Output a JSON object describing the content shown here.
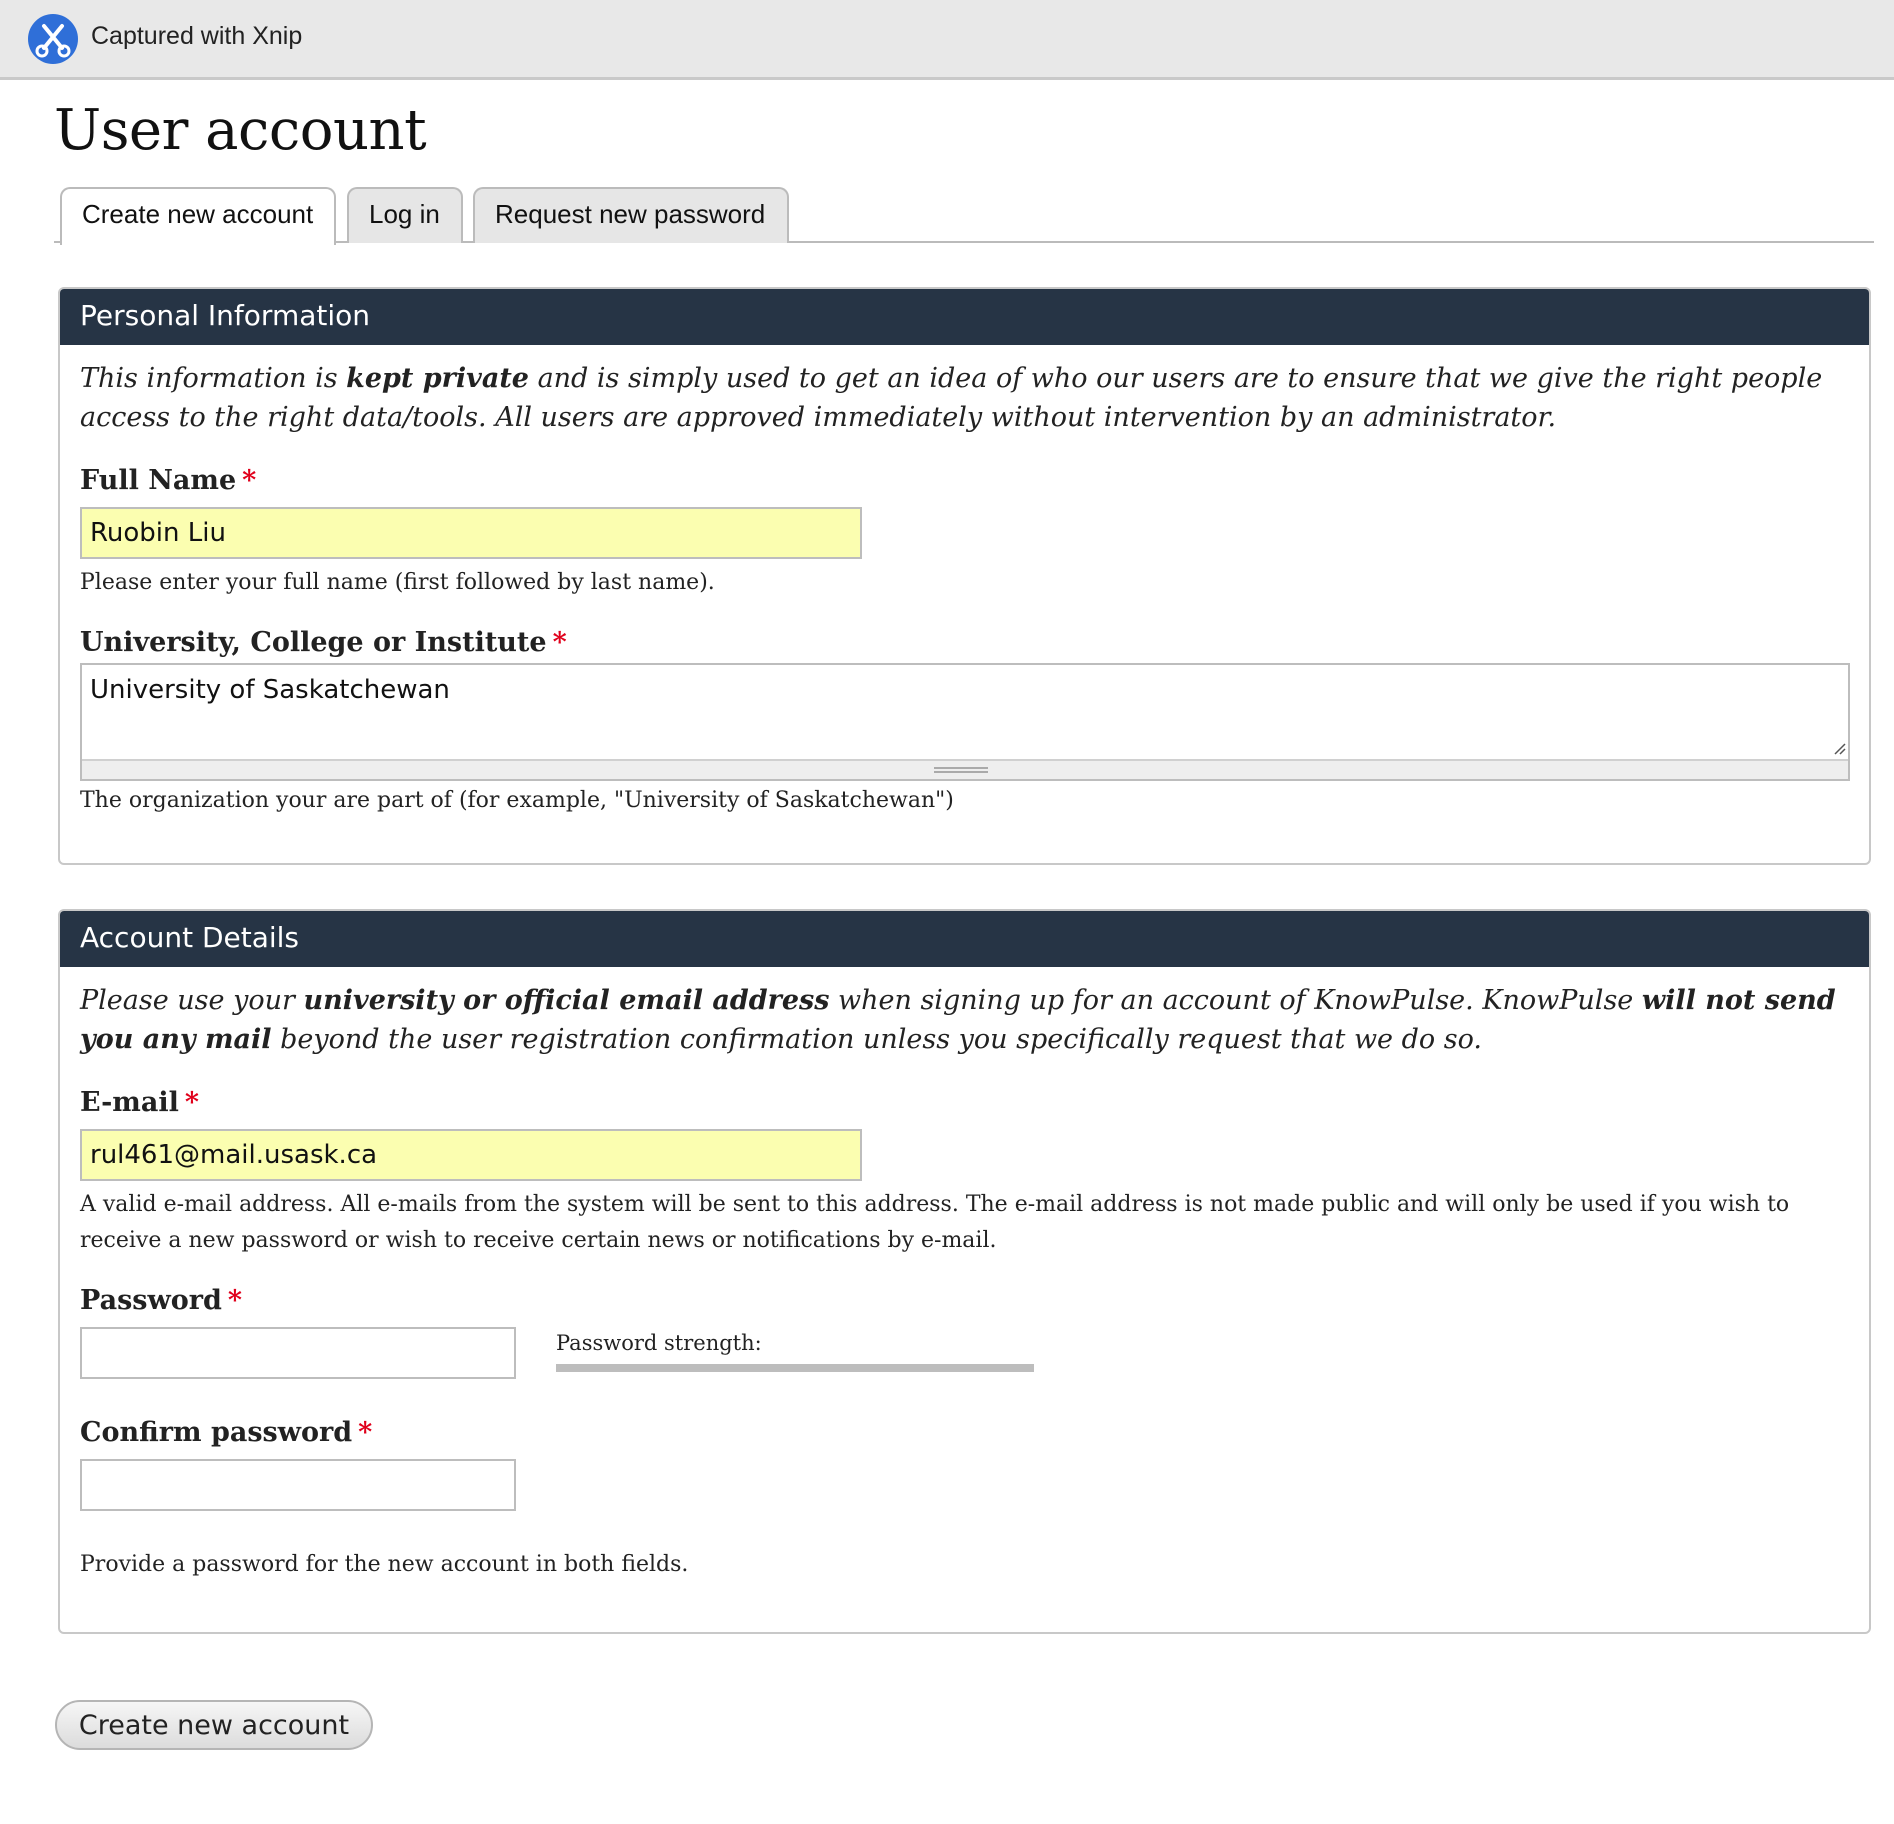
{
  "capture_bar": {
    "text": "Captured with Xnip",
    "icon": "scissors-icon",
    "accent": "#2f6fd8"
  },
  "page": {
    "title": "User account"
  },
  "tabs": [
    {
      "label": "Create new account",
      "active": true
    },
    {
      "label": "Log in",
      "active": false
    },
    {
      "label": "Request new password",
      "active": false
    }
  ],
  "personal": {
    "legend": "Personal Information",
    "intro_1": "This information is ",
    "intro_bold": "kept private",
    "intro_2": " and is simply used to get an idea of who our users are to ensure that we give the right people access to the right data/tools. All users are approved immediately without intervention by an administrator.",
    "full_name": {
      "label": "Full Name",
      "required": "*",
      "value": "Ruobin Liu",
      "help": "Please enter your full name (first followed by last name)."
    },
    "institute": {
      "label": "University, College or Institute",
      "required": "*",
      "value": "University of Saskatchewan",
      "help": "The organization your are part of (for example, \"University of Saskatchewan\")"
    }
  },
  "account": {
    "legend": "Account Details",
    "intro_1": "Please use your ",
    "intro_bold_1": "university or official email address",
    "intro_2": " when signing up for an account of KnowPulse. KnowPulse ",
    "intro_bold_2": "will not send you any mail",
    "intro_3": " beyond the user registration confirmation unless you specifically request that we do so.",
    "email": {
      "label": "E-mail",
      "required": "*",
      "value": "rul461@mail.usask.ca",
      "help": "A valid e-mail address. All e-mails from the system will be sent to this address. The e-mail address is not made public and will only be used if you wish to receive a new password or wish to receive certain news or notifications by e-mail."
    },
    "password": {
      "label": "Password",
      "required": "*",
      "value": "",
      "strength_label": "Password strength:",
      "strength_level": 0
    },
    "confirm_password": {
      "label": "Confirm password",
      "required": "*",
      "value": ""
    },
    "password_help": "Provide a password for the new account in both fields."
  },
  "submit": {
    "label": "Create new account"
  },
  "colors": {
    "legend_bg": "#263445",
    "required": "#e0001b",
    "autofill": "#fbfeb0"
  }
}
